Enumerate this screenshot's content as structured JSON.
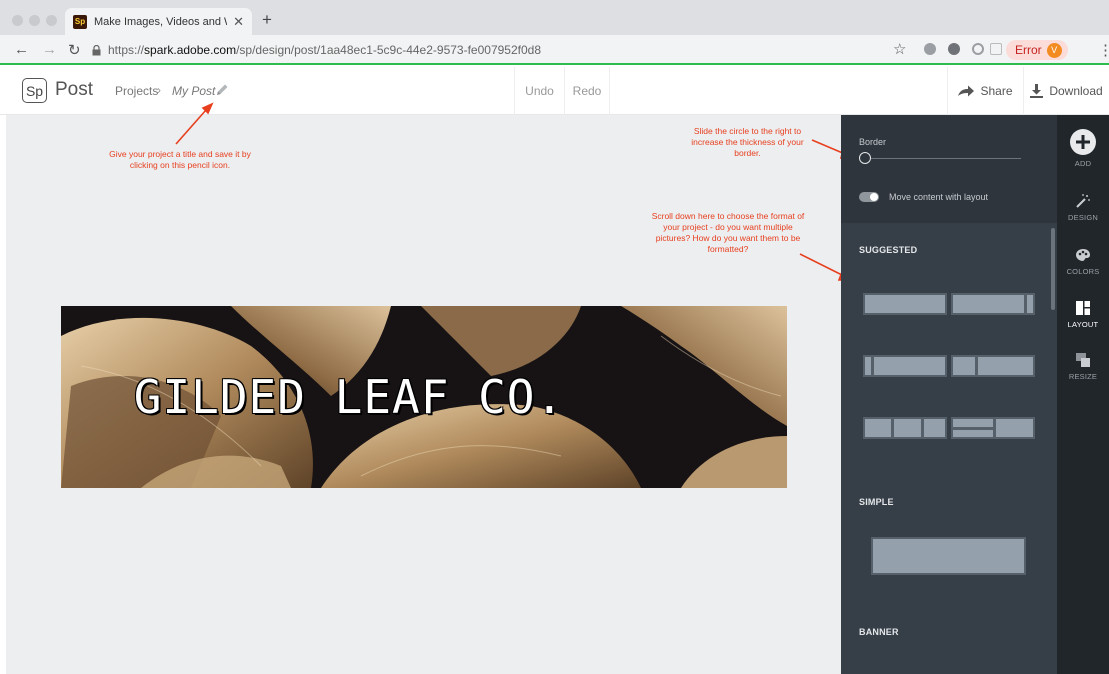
{
  "browser": {
    "tab_title": "Make Images, Videos and Web",
    "tab_favicon": "Sp",
    "url_scheme": "https://",
    "url_domain": "spark.adobe.com",
    "url_path": "/sp/design/post/1aa48ec1-5c9c-44e2-9573-fe007952f0d8",
    "error_label": "Error",
    "avatar_initial": "V"
  },
  "header": {
    "logo": "Sp",
    "app_name": "Post",
    "breadcrumb_projects": "Projects",
    "breadcrumb_sep": "›",
    "breadcrumb_current": "My Post",
    "undo": "Undo",
    "redo": "Redo",
    "share": "Share",
    "download": "Download"
  },
  "canvas": {
    "banner_title": "GILDED LEAF CO."
  },
  "annotations": {
    "pencil_note": "Give your project a title and save it by clicking on this pencil icon.",
    "border_note": "Slide the circle to the right to increase the thickness of your border.",
    "layout_note": "Scroll down here to choose the format of your project - do you want multiple pictures? How do you want them to be formatted?"
  },
  "panel": {
    "border_label": "Border",
    "border_value": 0,
    "toggle_label": "Move content with layout",
    "toggle_on": true,
    "section_suggested": "SUGGESTED",
    "section_simple": "SIMPLE",
    "section_banner": "BANNER"
  },
  "toolbar": {
    "add": "ADD",
    "design": "DESIGN",
    "colors": "COLORS",
    "layout": "LAYOUT",
    "resize": "RESIZE",
    "active": "LAYOUT"
  },
  "colors": {
    "annotation": "#e8401f",
    "panel": "#363e47",
    "toolbar": "#21262b",
    "canvas": "#eceef0",
    "tile": "#94a0ab"
  }
}
